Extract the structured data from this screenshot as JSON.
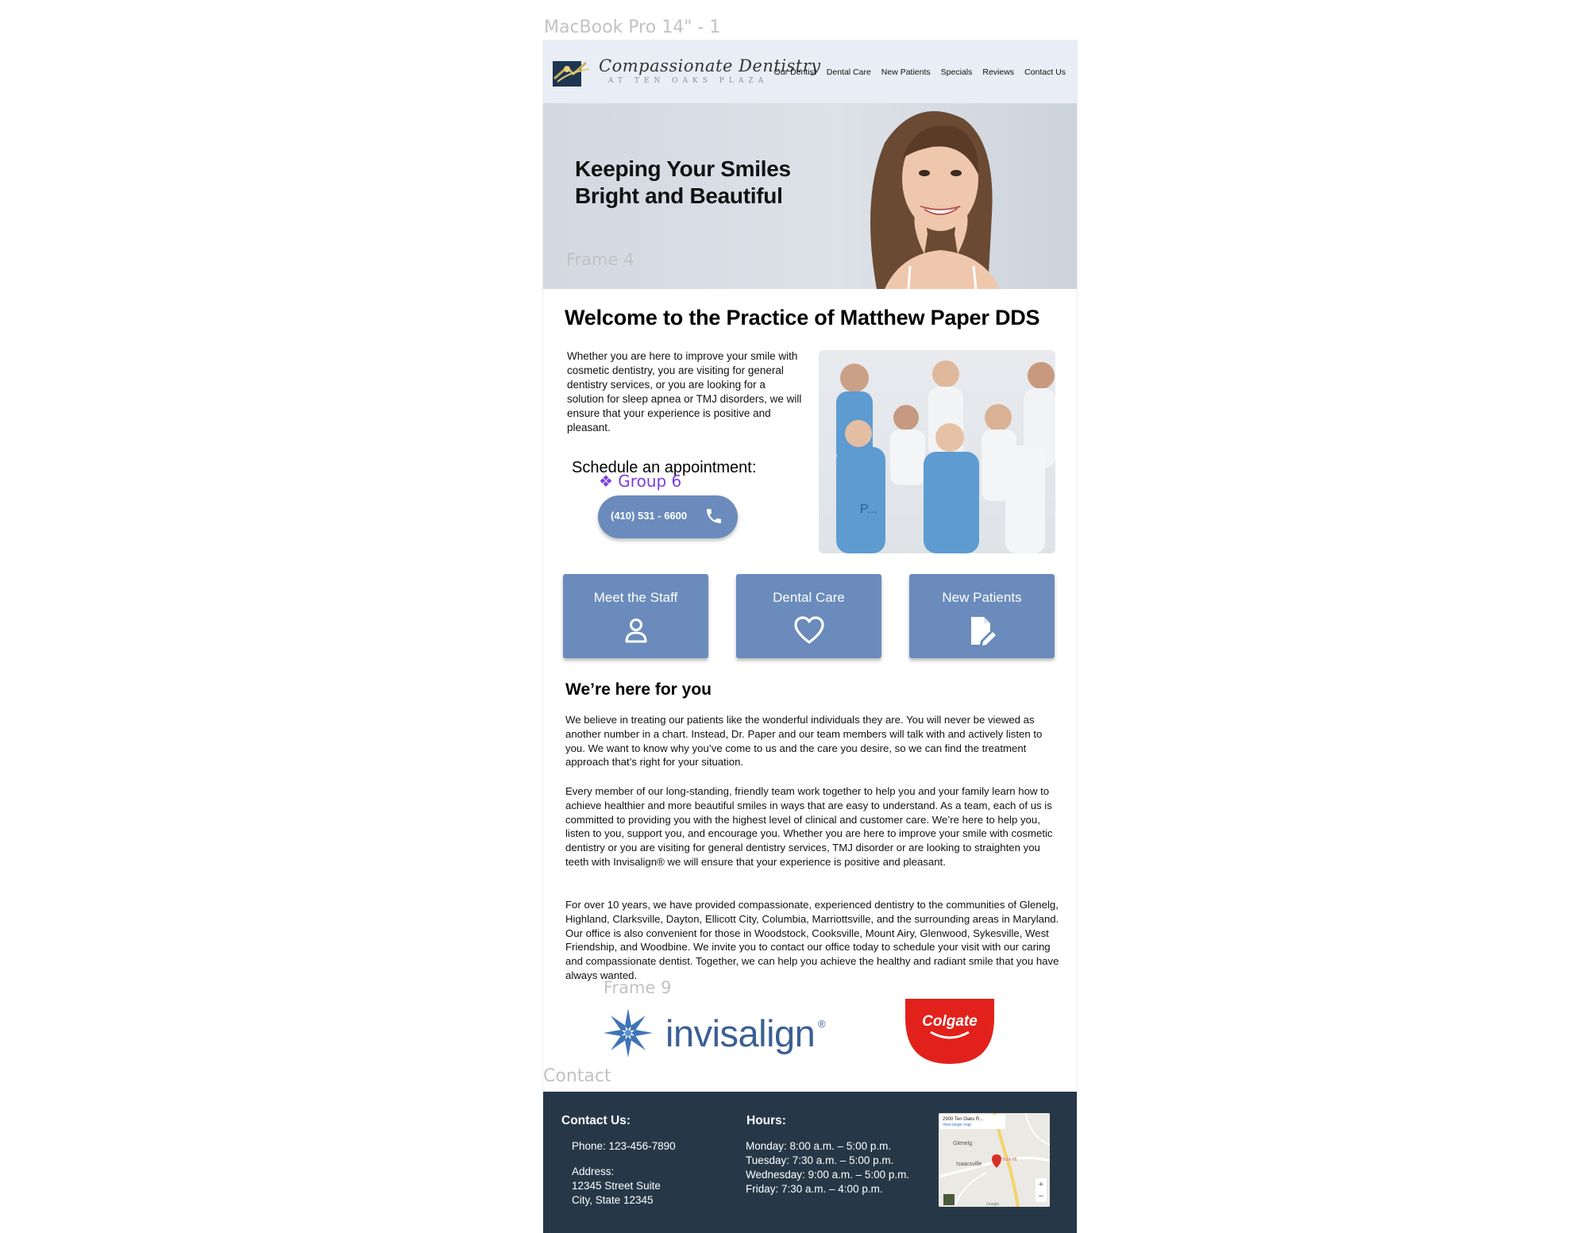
{
  "canvas": {
    "frame_label": "MacBook Pro 14\" - 1",
    "hero_frame_label": "Frame 4",
    "group_label": "Group 6",
    "logos_frame_label": "Frame 9",
    "contact_frame_label": "Contact"
  },
  "header": {
    "logo_title": "Compassionate Dentistry",
    "logo_subtitle": "AT TEN OAKS PLAZA",
    "nav": [
      "Our Dentist",
      "Dental Care",
      "New Patients",
      "Specials",
      "Reviews",
      "Contact Us"
    ]
  },
  "hero": {
    "title_line1": "Keeping Your Smiles",
    "title_line2": "Bright and Beautiful"
  },
  "welcome": {
    "title": "Welcome to the Practice of Matthew Paper DDS",
    "body": "Whether you are here to improve your smile with cosmetic dentistry, you are visiting for general dentistry services, or you are looking for a solution for sleep apnea or TMJ disorders, we will ensure that your experience is positive and pleasant.",
    "schedule_label": "Schedule an appointment:",
    "phone_button": "(410) 531 - 6600",
    "photo_overlay_text": "P..."
  },
  "cards": [
    {
      "label": "Meet the Staff",
      "icon": "person-icon"
    },
    {
      "label": "Dental Care",
      "icon": "heart-icon"
    },
    {
      "label": "New Patients",
      "icon": "document-edit-icon"
    }
  ],
  "here_for_you": {
    "title": "We’re here for you",
    "paragraphs": [
      "We believe in treating our patients like the wonderful individuals they are. You will never be viewed as another number in a chart. Instead, Dr. Paper and our team members will talk with and actively listen to you. We want to know why you’ve come to us and the care you desire, so we can find the treatment approach that’s right for your situation.",
      "Every member of our long-standing, friendly team work together to help you and your family learn how to achieve healthier and more beautiful smiles in ways that are easy to understand. As a team, each of us is committed to providing you with the highest level of clinical and customer care. We’re here to help you, listen to you, support you, and encourage you. Whether you are here to improve your smile with cosmetic dentistry or you are visiting for general dentistry services, TMJ  disorder or are looking to straighten you teeth with Invisalign®  we will ensure that your experience is positive and pleasant.",
      "For over 10 years, we have provided compassionate, experienced dentistry to the communities of Glenelg, Highland, Clarksville, Dayton, Ellicott City, Columbia, Marriottsville, and the surrounding areas in Maryland. Our office is also convenient for those in Woodstock, Cooksville, Mount Airy, Glenwood, Sykesville, West Friendship, and Woodbine. We invite you to contact our office today to schedule your visit with our caring and compassionate dentist. Together, we can help you achieve the healthy and radiant smile that you have always wanted."
    ]
  },
  "partners": {
    "invisalign": "invisalign",
    "invisalign_reg": "®",
    "colgate": "Colgate"
  },
  "footer": {
    "contact_heading": "Contact Us:",
    "phone": "Phone: 123-456-7890",
    "address_label": "Address:",
    "address_line1": "12345 Street Suite",
    "address_line2": "City, State 12345",
    "hours_heading": "Hours:",
    "hours": [
      "Monday: 8:00 a.m. – 5:00 p.m.",
      "Tuesday: 7:30 a.m. – 5:00 p.m.",
      "Wednesday: 9:00 a.m. – 5:00 p.m.",
      "Friday: 7:30 a.m. – 4:00 p.m."
    ],
    "map": {
      "place": "2900 Ten Oaks R...",
      "link": "View larger map",
      "town1": "Glenelg",
      "town2": "Isaacsville",
      "pin_label": "Suite #5",
      "zoom_in": "+",
      "zoom_out": "−",
      "attribution": "Google"
    }
  },
  "colors": {
    "header_bg": "#e9edf6",
    "button_blue": "#6a8bbb",
    "footer_bg": "#263848",
    "group_purple": "#7b3fe0",
    "colgate_red": "#e2211c",
    "invisalign_blue": "#3b5f95"
  }
}
